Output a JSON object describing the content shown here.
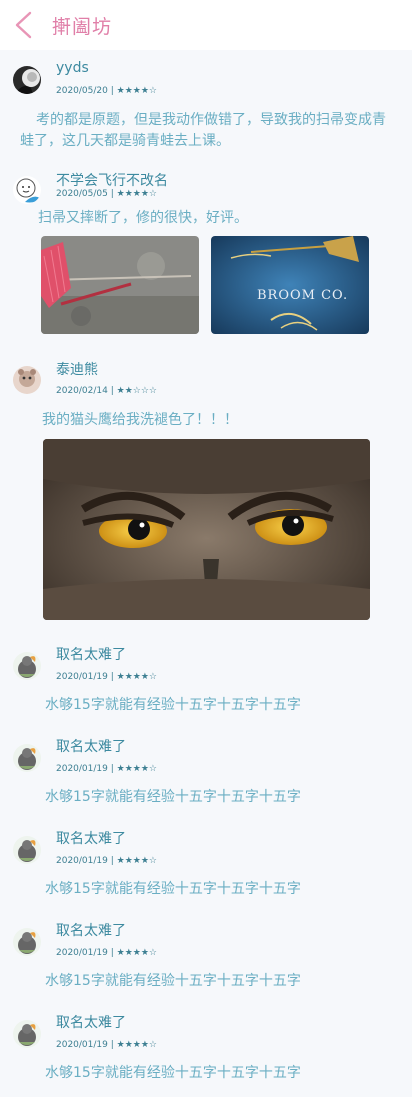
{
  "header": {
    "title": "搟阖坊"
  },
  "reviews": [
    {
      "name": "yyds",
      "date": "2020/05/20",
      "stars": "★★★★☆",
      "body": "考的都是原题，但是我动作做错了，导致我的扫帚变成青蛙了，这几天都是骑青蛙去上课。"
    },
    {
      "name": "不学会飞行不改名",
      "date": "2020/05/05",
      "stars": "★★★★☆",
      "body": "扫帚又摔断了，修的很快，好评。",
      "photo_text": "BROOM CO."
    },
    {
      "name": "泰迪熊",
      "date": "2020/02/14",
      "stars": "★★☆☆☆",
      "body": "我的猫头鹰给我洗褪色了！！！"
    },
    {
      "name": "取名太难了",
      "date": "2020/01/19",
      "stars": "★★★★☆",
      "body": "水够15字就能有经验十五字十五字十五字"
    },
    {
      "name": "取名太难了",
      "date": "2020/01/19",
      "stars": "★★★★☆",
      "body": "水够15字就能有经验十五字十五字十五字"
    },
    {
      "name": "取名太难了",
      "date": "2020/01/19",
      "stars": "★★★★☆",
      "body": "水够15字就能有经验十五字十五字十五字"
    },
    {
      "name": "取名太难了",
      "date": "2020/01/19",
      "stars": "★★★★☆",
      "body": "水够15字就能有经验十五字十五字十五字"
    },
    {
      "name": "取名太难了",
      "date": "2020/01/19",
      "stars": "★★★★☆",
      "body": "水够15字就能有经验十五字十五字十五字"
    }
  ]
}
